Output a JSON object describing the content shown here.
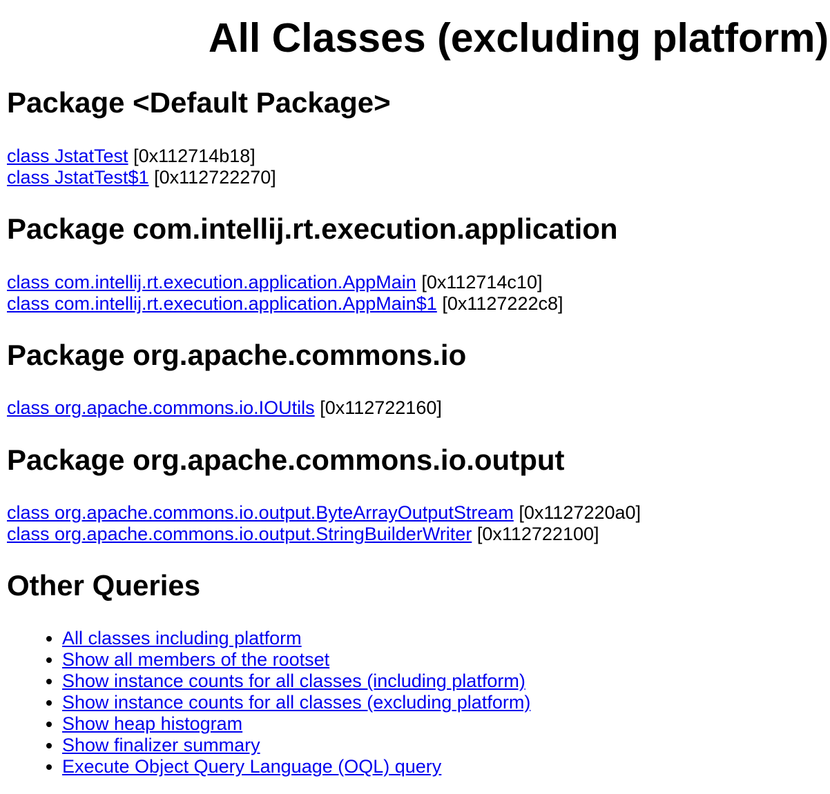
{
  "page": {
    "title": "All Classes (excluding platform)"
  },
  "sections": [
    {
      "heading": "Package <Default Package>",
      "classes": [
        {
          "label": "class JstatTest",
          "address": "[0x112714b18]"
        },
        {
          "label": "class JstatTest$1",
          "address": "[0x112722270]"
        }
      ]
    },
    {
      "heading": "Package com.intellij.rt.execution.application",
      "classes": [
        {
          "label": "class com.intellij.rt.execution.application.AppMain",
          "address": "[0x112714c10]"
        },
        {
          "label": "class com.intellij.rt.execution.application.AppMain$1",
          "address": "[0x1127222c8]"
        }
      ]
    },
    {
      "heading": "Package org.apache.commons.io",
      "classes": [
        {
          "label": "class org.apache.commons.io.IOUtils",
          "address": "[0x112722160]"
        }
      ]
    },
    {
      "heading": "Package org.apache.commons.io.output",
      "classes": [
        {
          "label": "class org.apache.commons.io.output.ByteArrayOutputStream",
          "address": "[0x1127220a0]"
        },
        {
          "label": "class org.apache.commons.io.output.StringBuilderWriter",
          "address": "[0x112722100]"
        }
      ]
    }
  ],
  "other_queries": {
    "heading": "Other Queries",
    "links": [
      "All classes including platform",
      "Show all members of the rootset",
      "Show instance counts for all classes (including platform)",
      "Show instance counts for all classes (excluding platform)",
      "Show heap histogram",
      "Show finalizer summary",
      "Execute Object Query Language (OQL) query"
    ]
  },
  "colors": {
    "link": "#0000ee",
    "text": "#000000",
    "background": "#ffffff"
  }
}
